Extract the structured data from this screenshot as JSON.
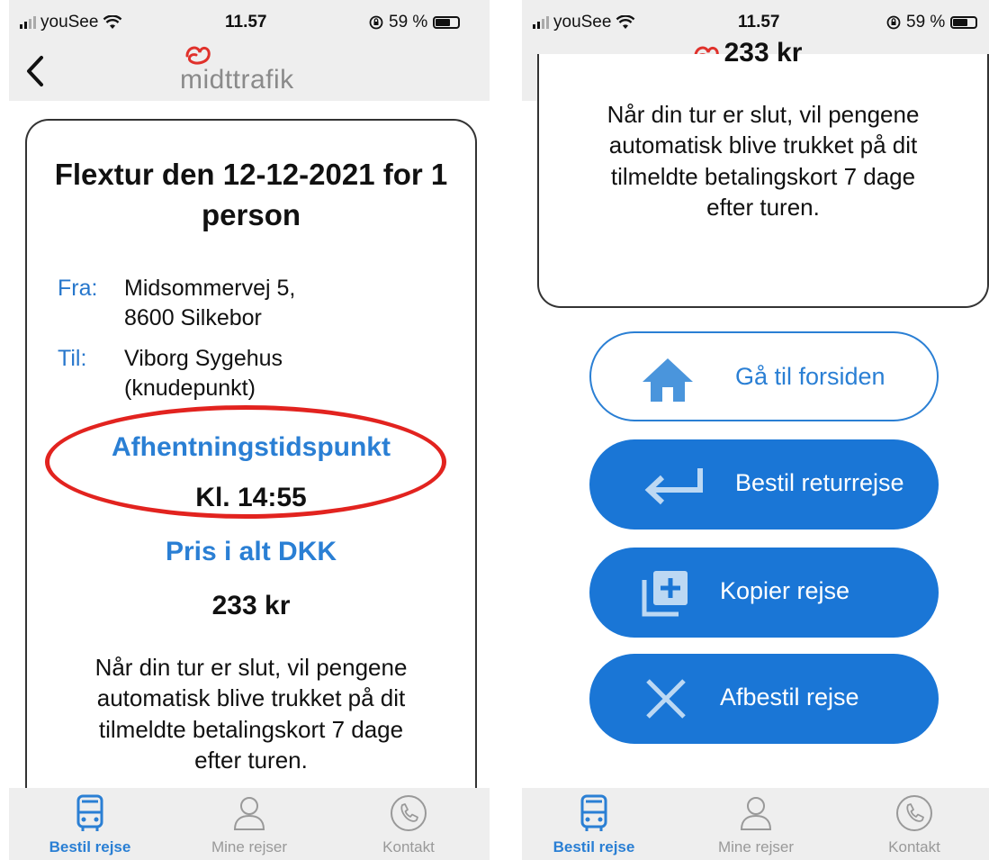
{
  "status_bar": {
    "carrier": "youSee",
    "time": "11.57",
    "battery": "59 %"
  },
  "header": {
    "logo_text": "midttrafik"
  },
  "confirmation": {
    "title": "Flextur den 12-12-2021 for 1 person",
    "from_label": "Fra:",
    "from_value_line1": "Midsommervej 5,",
    "from_value_line2": "8600 Silkebor",
    "to_label": "Til:",
    "to_value_line1": "Viborg Sygehus",
    "to_value_line2": "(knudepunkt)",
    "pickup_label": "Afhentningstidspunkt",
    "pickup_value": "Kl. 14:55",
    "price_label": "Pris i alt DKK",
    "price_value": "233 kr",
    "note_line1": "Når din tur er slut, vil pengene",
    "note_line2": "automatisk blive trukket på dit",
    "note_line3": "tilmeldte betalingskort 7 dage",
    "note_line4": "efter turen."
  },
  "actions": {
    "home": "Gå til forsiden",
    "return_trip": "Bestil returrejse",
    "copy_trip": "Kopier rejse",
    "cancel_trip": "Afbestil rejse"
  },
  "tabs": [
    {
      "label": "Bestil rejse",
      "icon": "bus-icon",
      "active": true
    },
    {
      "label": "Mine rejser",
      "icon": "person-icon",
      "active": false
    },
    {
      "label": "Kontakt",
      "icon": "phone-icon",
      "active": false
    }
  ],
  "colors": {
    "accent": "#1a76d6",
    "highlight": "#e2231f",
    "logo_red": "#e0312b"
  }
}
